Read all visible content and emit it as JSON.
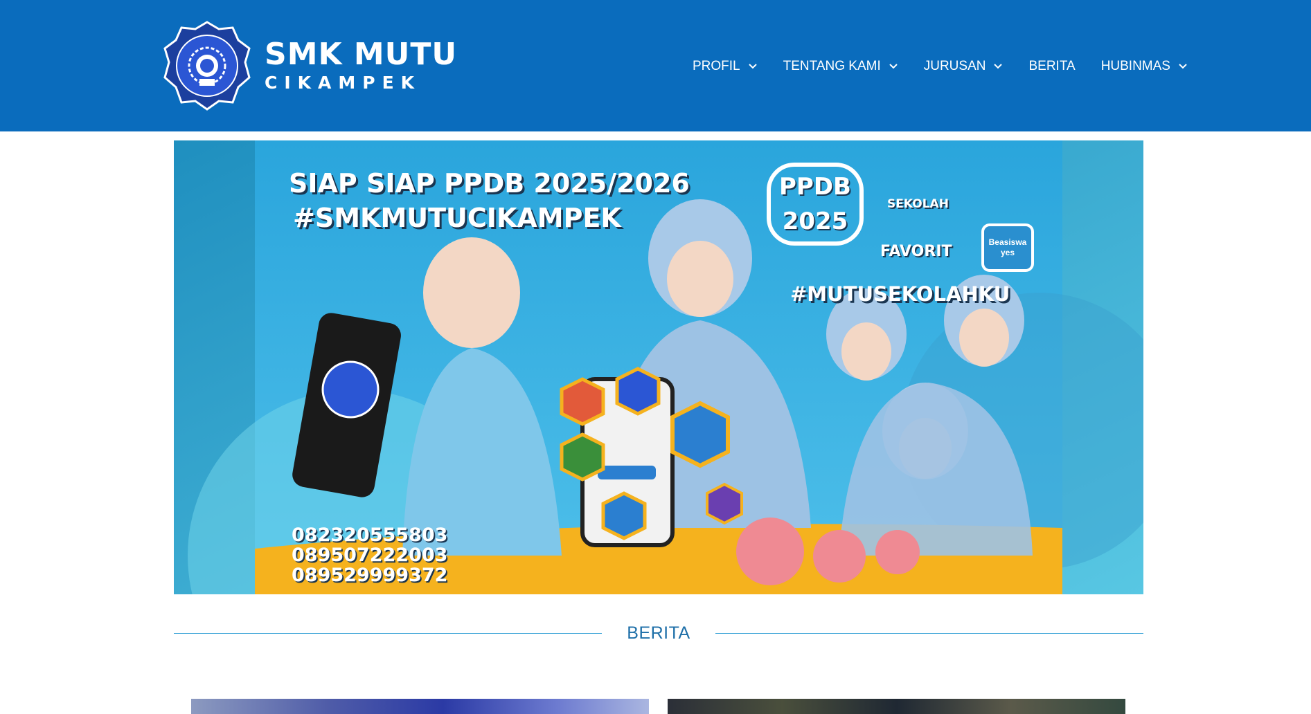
{
  "header": {
    "brand_line1": "SMK MUTU",
    "brand_line2": "CIKAMPEK",
    "background_color": "#0a6cbd"
  },
  "nav": {
    "items": [
      {
        "label": "PROFIL",
        "has_dropdown": true
      },
      {
        "label": "TENTANG KAMI",
        "has_dropdown": true
      },
      {
        "label": "JURUSAN",
        "has_dropdown": true
      },
      {
        "label": "BERITA",
        "has_dropdown": false
      },
      {
        "label": "HUBINMAS",
        "has_dropdown": true
      }
    ]
  },
  "banner": {
    "headline": "SIAP SIAP PPDB 2025/2026",
    "hashtag": "#SMKMUTUCIKAMPEK",
    "ppdb_badge": "PPDB 2025",
    "sekolah": "SEKOLAH",
    "favorit": "FAVORIT",
    "beasiswa": "Beasiswa yes",
    "hashtag2": "#MUTUSEKOLAHKU",
    "phones": [
      "082320555803",
      "089507222003",
      "089529999372"
    ],
    "slides_count": 3,
    "active_slide": 1,
    "dot_color": "#ef8a93"
  },
  "berita": {
    "title": "BERITA",
    "rule_color": "#3aa3d7"
  },
  "icons": {
    "chevron": "chevron-down-icon",
    "logo": "school-emblem-icon"
  }
}
